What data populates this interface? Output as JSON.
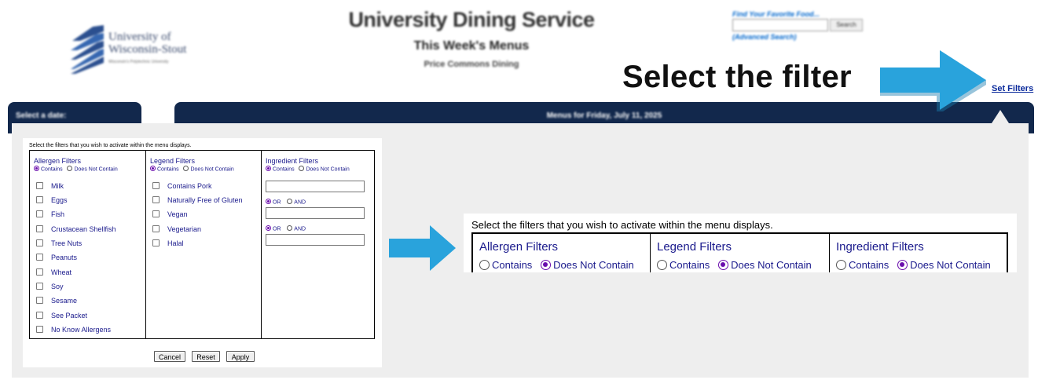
{
  "header": {
    "logo_line1": "University of",
    "logo_line2": "Wisconsin-Stout",
    "logo_line3": "Wisconsin's Polytechnic University",
    "title": "University Dining Service",
    "subtitle": "This Week's Menus",
    "location": "Price Commons Dining",
    "find_food_label": "Find Your Favorite Food...",
    "search_button": "Search",
    "advanced_search": "(Advanced Search)",
    "set_filters": "Set Filters",
    "select_date_label": "Select a date:",
    "menus_for": "Menus for Friday, July 11, 2025"
  },
  "callout": {
    "text": "Select the filter",
    "arrow_color": "#29a3dc"
  },
  "dialog": {
    "instructions": "Select the filters that you wish to activate within the menu displays.",
    "columns": [
      {
        "heading": "Allergen Filters",
        "contains": "Contains",
        "not_contains": "Does Not Contain",
        "selected": "Contains",
        "items": [
          "Milk",
          "Eggs",
          "Fish",
          "Crustacean Shellfish",
          "Tree Nuts",
          "Peanuts",
          "Wheat",
          "Soy",
          "Sesame",
          "See Packet",
          "No Know Allergens"
        ]
      },
      {
        "heading": "Legend Filters",
        "contains": "Contains",
        "not_contains": "Does Not Contain",
        "selected": "Contains",
        "items": [
          "Contains Pork",
          "Naturally Free of Gluten",
          "Vegan",
          "Vegetarian",
          "Halal"
        ]
      },
      {
        "heading": "Ingredient Filters",
        "contains": "Contains",
        "not_contains": "Does Not Contain",
        "selected": "Contains",
        "or_label": "OR",
        "and_label": "AND"
      }
    ],
    "buttons": {
      "cancel": "Cancel",
      "reset": "Reset",
      "apply": "Apply"
    }
  },
  "zoom": {
    "instructions": "Select the filters that you wish to activate within the menu displays.",
    "columns": [
      {
        "heading": "Allergen Filters",
        "contains": "Contains",
        "not_contains": "Does Not Contain",
        "selected": "Does Not Contain"
      },
      {
        "heading": "Legend Filters",
        "contains": "Contains",
        "not_contains": "Does Not Contain",
        "selected": "Does Not Contain"
      },
      {
        "heading": "Ingredient Filters",
        "contains": "Contains",
        "not_contains": "Does Not Contain",
        "selected": "Does Not Contain"
      }
    ]
  },
  "colors": {
    "navy": "#12284c",
    "link_blue": "#0a2a9c",
    "label_blue": "#1a1a8c",
    "radio_purple": "#6a0dad",
    "panel_gray": "#eeeeee",
    "arrow_blue": "#29a3dc"
  }
}
